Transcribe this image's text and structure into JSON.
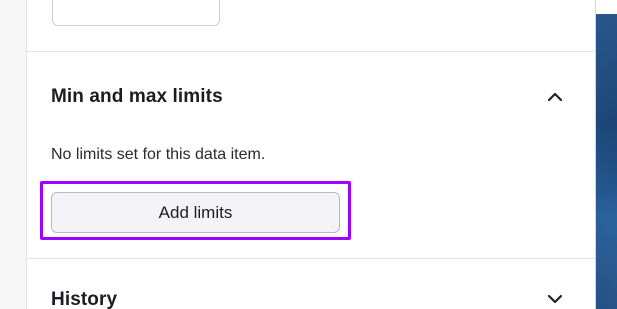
{
  "limits_section": {
    "title": "Min and max limits",
    "helper_text": "No limits set for this data item.",
    "add_button_label": "Add limits",
    "expanded": true,
    "toggle_icon": "chevron-up-icon"
  },
  "history_section": {
    "title": "History",
    "expanded": false,
    "toggle_icon": "chevron-down-icon"
  },
  "colors": {
    "highlight": "#a100ff",
    "background_blue": "#1e4f87"
  }
}
